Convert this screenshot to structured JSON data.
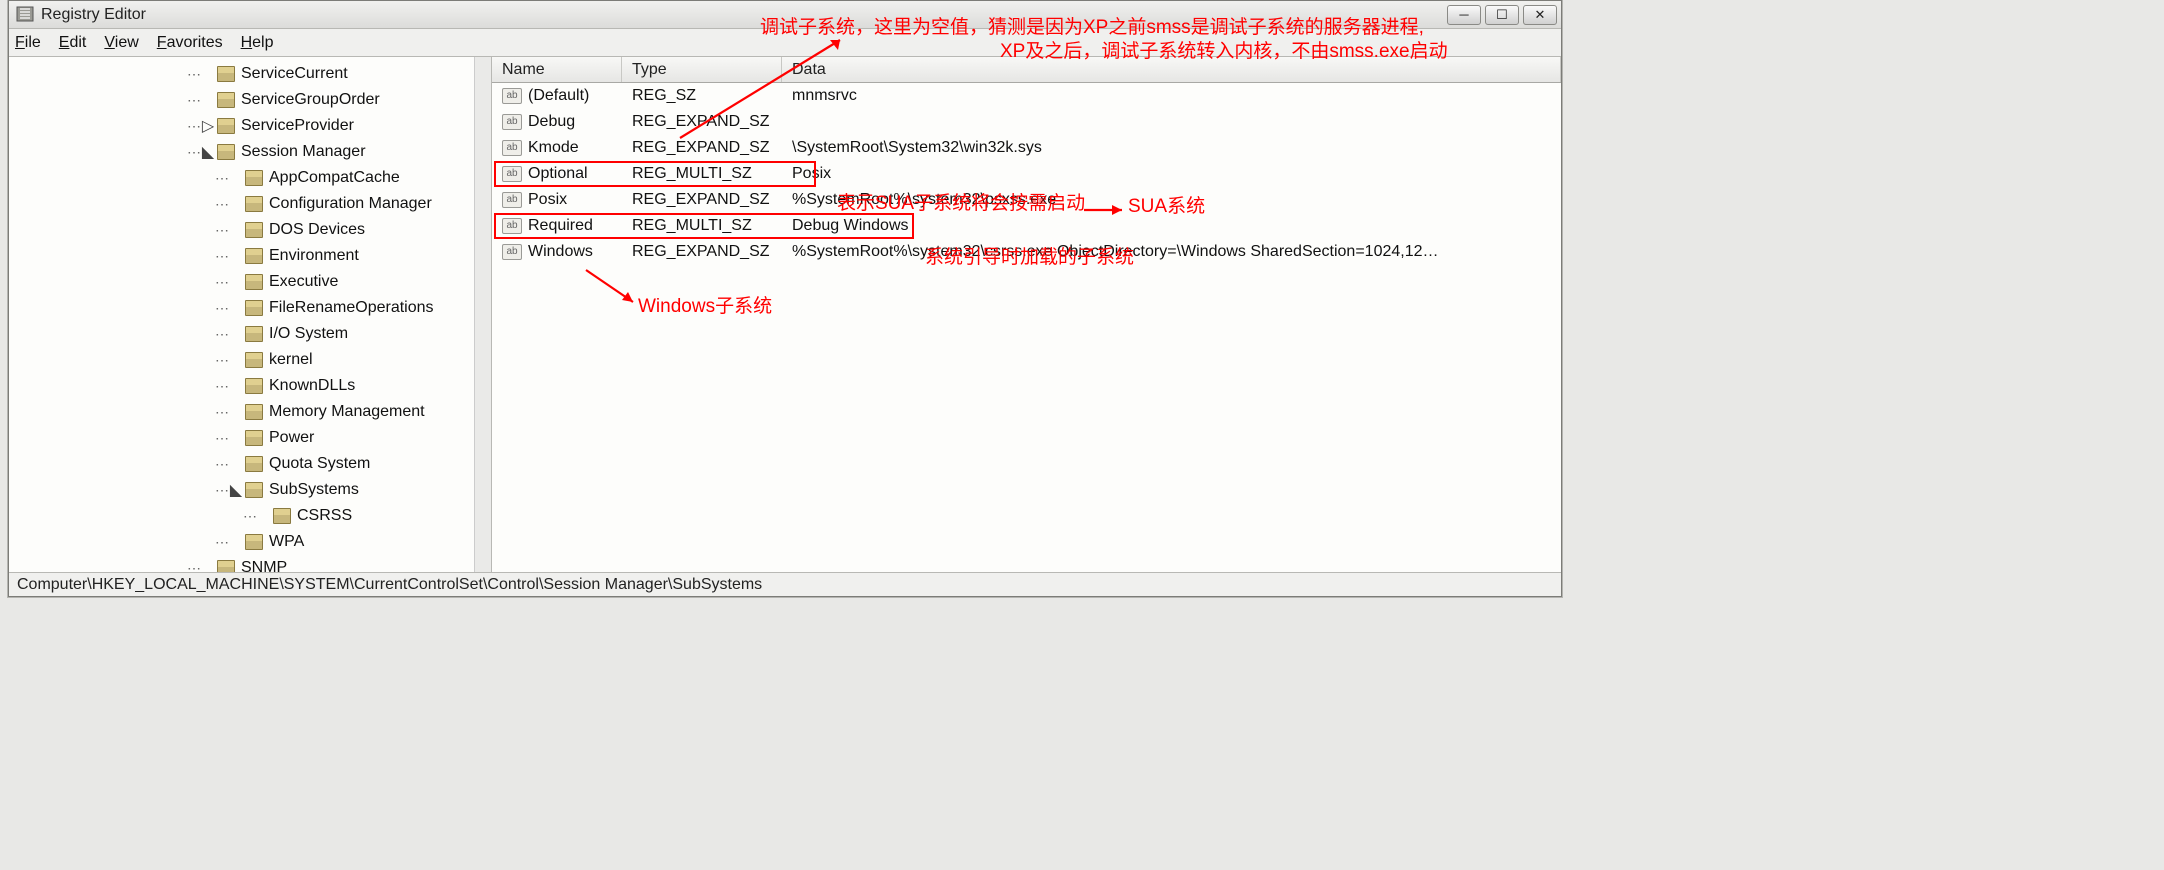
{
  "window": {
    "title": "Registry Editor"
  },
  "menubar": {
    "items": [
      "File",
      "Edit",
      "View",
      "Favorites",
      "Help"
    ]
  },
  "tree": {
    "nodes": [
      {
        "depth": 1,
        "expander": "",
        "name": "ServiceCurrent"
      },
      {
        "depth": 1,
        "expander": "",
        "name": "ServiceGroupOrder"
      },
      {
        "depth": 1,
        "expander": "▷",
        "name": "ServiceProvider"
      },
      {
        "depth": 1,
        "expander": "◣",
        "name": "Session Manager"
      },
      {
        "depth": 2,
        "expander": "",
        "name": "AppCompatCache"
      },
      {
        "depth": 2,
        "expander": "",
        "name": "Configuration Manager"
      },
      {
        "depth": 2,
        "expander": "",
        "name": "DOS Devices"
      },
      {
        "depth": 2,
        "expander": "",
        "name": "Environment"
      },
      {
        "depth": 2,
        "expander": "",
        "name": "Executive"
      },
      {
        "depth": 2,
        "expander": "",
        "name": "FileRenameOperations"
      },
      {
        "depth": 2,
        "expander": "",
        "name": "I/O System"
      },
      {
        "depth": 2,
        "expander": "",
        "name": "kernel"
      },
      {
        "depth": 2,
        "expander": "",
        "name": "KnownDLLs"
      },
      {
        "depth": 2,
        "expander": "",
        "name": "Memory Management"
      },
      {
        "depth": 2,
        "expander": "",
        "name": "Power"
      },
      {
        "depth": 2,
        "expander": "",
        "name": "Quota System"
      },
      {
        "depth": 2,
        "expander": "◣",
        "name": "SubSystems"
      },
      {
        "depth": 3,
        "expander": "",
        "name": "CSRSS"
      },
      {
        "depth": 2,
        "expander": "",
        "name": "WPA"
      },
      {
        "depth": 1,
        "expander": "",
        "name": "SNMP"
      }
    ]
  },
  "list": {
    "columns": {
      "name": "Name",
      "type": "Type",
      "data": "Data"
    },
    "rows": [
      {
        "icon": "ab",
        "name": "(Default)",
        "type": "REG_SZ",
        "data": "mnmsrvc"
      },
      {
        "icon": "ab",
        "name": "Debug",
        "type": "REG_EXPAND_SZ",
        "data": ""
      },
      {
        "icon": "ab",
        "name": "Kmode",
        "type": "REG_EXPAND_SZ",
        "data": "\\SystemRoot\\System32\\win32k.sys"
      },
      {
        "icon": "ab",
        "name": "Optional",
        "type": "REG_MULTI_SZ",
        "data": "Posix"
      },
      {
        "icon": "ab",
        "name": "Posix",
        "type": "REG_EXPAND_SZ",
        "data": "%SystemRoot%\\system32\\psxss.exe"
      },
      {
        "icon": "ab",
        "name": "Required",
        "type": "REG_MULTI_SZ",
        "data": "Debug Windows"
      },
      {
        "icon": "ab",
        "name": "Windows",
        "type": "REG_EXPAND_SZ",
        "data": "%SystemRoot%\\system32\\csrss.exe ObjectDirectory=\\Windows SharedSection=1024,12…"
      }
    ]
  },
  "statusbar": {
    "path": "Computer\\HKEY_LOCAL_MACHINE\\SYSTEM\\CurrentControlSet\\Control\\Session Manager\\SubSystems"
  },
  "annotations": {
    "top1": "调试子系统，这里为空值，猜测是因为XP之前smss是调试子系统的服务器进程,",
    "top2": "XP及之后，调试子系统转入内核，不由smss.exe启动",
    "optional": "表示SUA子系统将会按需启动",
    "sua": "SUA系统",
    "required": "系统引导时加载的子系统",
    "windows": "Windows子系统"
  }
}
